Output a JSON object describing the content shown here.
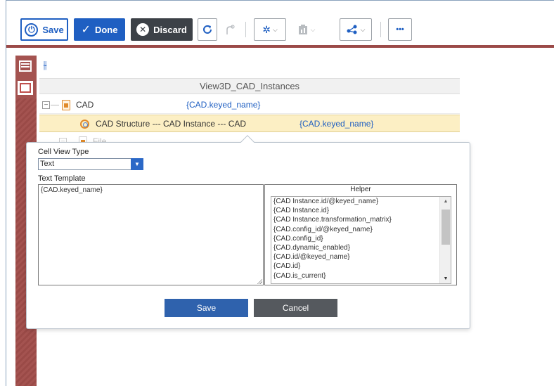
{
  "toolbar": {
    "save_label": "Save",
    "done_label": "Done",
    "discard_label": "Discard",
    "more_label": "•••"
  },
  "grid": {
    "header": "View3D_CAD_Instances",
    "rows": [
      {
        "label": "CAD",
        "value": "{CAD.keyed_name}"
      },
      {
        "label": "CAD Structure --- CAD Instance --- CAD",
        "value": "{CAD.keyed_name}"
      },
      {
        "label": "File"
      }
    ]
  },
  "dialog": {
    "cell_view_type_label": "Cell View Type",
    "cell_view_type_value": "Text",
    "text_template_label": "Text Template",
    "text_template_value": "{CAD.keyed_name}",
    "helper_title": "Helper",
    "helper_items": [
      "{CAD Instance.id/@keyed_name}",
      "{CAD Instance.id}",
      "{CAD Instance.transformation_matrix}",
      "{CAD.config_id/@keyed_name}",
      "{CAD.config_id}",
      "{CAD.dynamic_enabled}",
      "{CAD.id/@keyed_name}",
      "{CAD.id}",
      "{CAD.is_current}"
    ],
    "save_label": "Save",
    "cancel_label": "Cancel"
  },
  "colors": {
    "accent": "#1f5fc2",
    "rail": "#a45350",
    "selected_row": "#fcefc4"
  }
}
